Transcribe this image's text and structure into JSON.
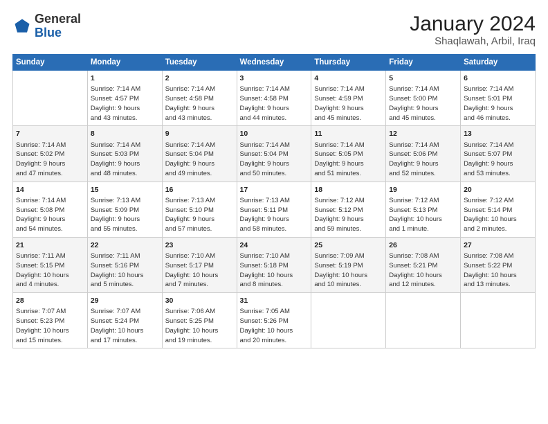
{
  "header": {
    "logo_general": "General",
    "logo_blue": "Blue",
    "title": "January 2024",
    "subtitle": "Shaqlawah, Arbil, Iraq"
  },
  "calendar": {
    "days_of_week": [
      "Sunday",
      "Monday",
      "Tuesday",
      "Wednesday",
      "Thursday",
      "Friday",
      "Saturday"
    ],
    "weeks": [
      [
        {
          "day": "",
          "content": ""
        },
        {
          "day": "1",
          "content": "Sunrise: 7:14 AM\nSunset: 4:57 PM\nDaylight: 9 hours\nand 43 minutes."
        },
        {
          "day": "2",
          "content": "Sunrise: 7:14 AM\nSunset: 4:58 PM\nDaylight: 9 hours\nand 43 minutes."
        },
        {
          "day": "3",
          "content": "Sunrise: 7:14 AM\nSunset: 4:58 PM\nDaylight: 9 hours\nand 44 minutes."
        },
        {
          "day": "4",
          "content": "Sunrise: 7:14 AM\nSunset: 4:59 PM\nDaylight: 9 hours\nand 45 minutes."
        },
        {
          "day": "5",
          "content": "Sunrise: 7:14 AM\nSunset: 5:00 PM\nDaylight: 9 hours\nand 45 minutes."
        },
        {
          "day": "6",
          "content": "Sunrise: 7:14 AM\nSunset: 5:01 PM\nDaylight: 9 hours\nand 46 minutes."
        }
      ],
      [
        {
          "day": "7",
          "content": "Sunrise: 7:14 AM\nSunset: 5:02 PM\nDaylight: 9 hours\nand 47 minutes."
        },
        {
          "day": "8",
          "content": "Sunrise: 7:14 AM\nSunset: 5:03 PM\nDaylight: 9 hours\nand 48 minutes."
        },
        {
          "day": "9",
          "content": "Sunrise: 7:14 AM\nSunset: 5:04 PM\nDaylight: 9 hours\nand 49 minutes."
        },
        {
          "day": "10",
          "content": "Sunrise: 7:14 AM\nSunset: 5:04 PM\nDaylight: 9 hours\nand 50 minutes."
        },
        {
          "day": "11",
          "content": "Sunrise: 7:14 AM\nSunset: 5:05 PM\nDaylight: 9 hours\nand 51 minutes."
        },
        {
          "day": "12",
          "content": "Sunrise: 7:14 AM\nSunset: 5:06 PM\nDaylight: 9 hours\nand 52 minutes."
        },
        {
          "day": "13",
          "content": "Sunrise: 7:14 AM\nSunset: 5:07 PM\nDaylight: 9 hours\nand 53 minutes."
        }
      ],
      [
        {
          "day": "14",
          "content": "Sunrise: 7:14 AM\nSunset: 5:08 PM\nDaylight: 9 hours\nand 54 minutes."
        },
        {
          "day": "15",
          "content": "Sunrise: 7:13 AM\nSunset: 5:09 PM\nDaylight: 9 hours\nand 55 minutes."
        },
        {
          "day": "16",
          "content": "Sunrise: 7:13 AM\nSunset: 5:10 PM\nDaylight: 9 hours\nand 57 minutes."
        },
        {
          "day": "17",
          "content": "Sunrise: 7:13 AM\nSunset: 5:11 PM\nDaylight: 9 hours\nand 58 minutes."
        },
        {
          "day": "18",
          "content": "Sunrise: 7:12 AM\nSunset: 5:12 PM\nDaylight: 9 hours\nand 59 minutes."
        },
        {
          "day": "19",
          "content": "Sunrise: 7:12 AM\nSunset: 5:13 PM\nDaylight: 10 hours\nand 1 minute."
        },
        {
          "day": "20",
          "content": "Sunrise: 7:12 AM\nSunset: 5:14 PM\nDaylight: 10 hours\nand 2 minutes."
        }
      ],
      [
        {
          "day": "21",
          "content": "Sunrise: 7:11 AM\nSunset: 5:15 PM\nDaylight: 10 hours\nand 4 minutes."
        },
        {
          "day": "22",
          "content": "Sunrise: 7:11 AM\nSunset: 5:16 PM\nDaylight: 10 hours\nand 5 minutes."
        },
        {
          "day": "23",
          "content": "Sunrise: 7:10 AM\nSunset: 5:17 PM\nDaylight: 10 hours\nand 7 minutes."
        },
        {
          "day": "24",
          "content": "Sunrise: 7:10 AM\nSunset: 5:18 PM\nDaylight: 10 hours\nand 8 minutes."
        },
        {
          "day": "25",
          "content": "Sunrise: 7:09 AM\nSunset: 5:19 PM\nDaylight: 10 hours\nand 10 minutes."
        },
        {
          "day": "26",
          "content": "Sunrise: 7:08 AM\nSunset: 5:21 PM\nDaylight: 10 hours\nand 12 minutes."
        },
        {
          "day": "27",
          "content": "Sunrise: 7:08 AM\nSunset: 5:22 PM\nDaylight: 10 hours\nand 13 minutes."
        }
      ],
      [
        {
          "day": "28",
          "content": "Sunrise: 7:07 AM\nSunset: 5:23 PM\nDaylight: 10 hours\nand 15 minutes."
        },
        {
          "day": "29",
          "content": "Sunrise: 7:07 AM\nSunset: 5:24 PM\nDaylight: 10 hours\nand 17 minutes."
        },
        {
          "day": "30",
          "content": "Sunrise: 7:06 AM\nSunset: 5:25 PM\nDaylight: 10 hours\nand 19 minutes."
        },
        {
          "day": "31",
          "content": "Sunrise: 7:05 AM\nSunset: 5:26 PM\nDaylight: 10 hours\nand 20 minutes."
        },
        {
          "day": "",
          "content": ""
        },
        {
          "day": "",
          "content": ""
        },
        {
          "day": "",
          "content": ""
        }
      ]
    ]
  }
}
